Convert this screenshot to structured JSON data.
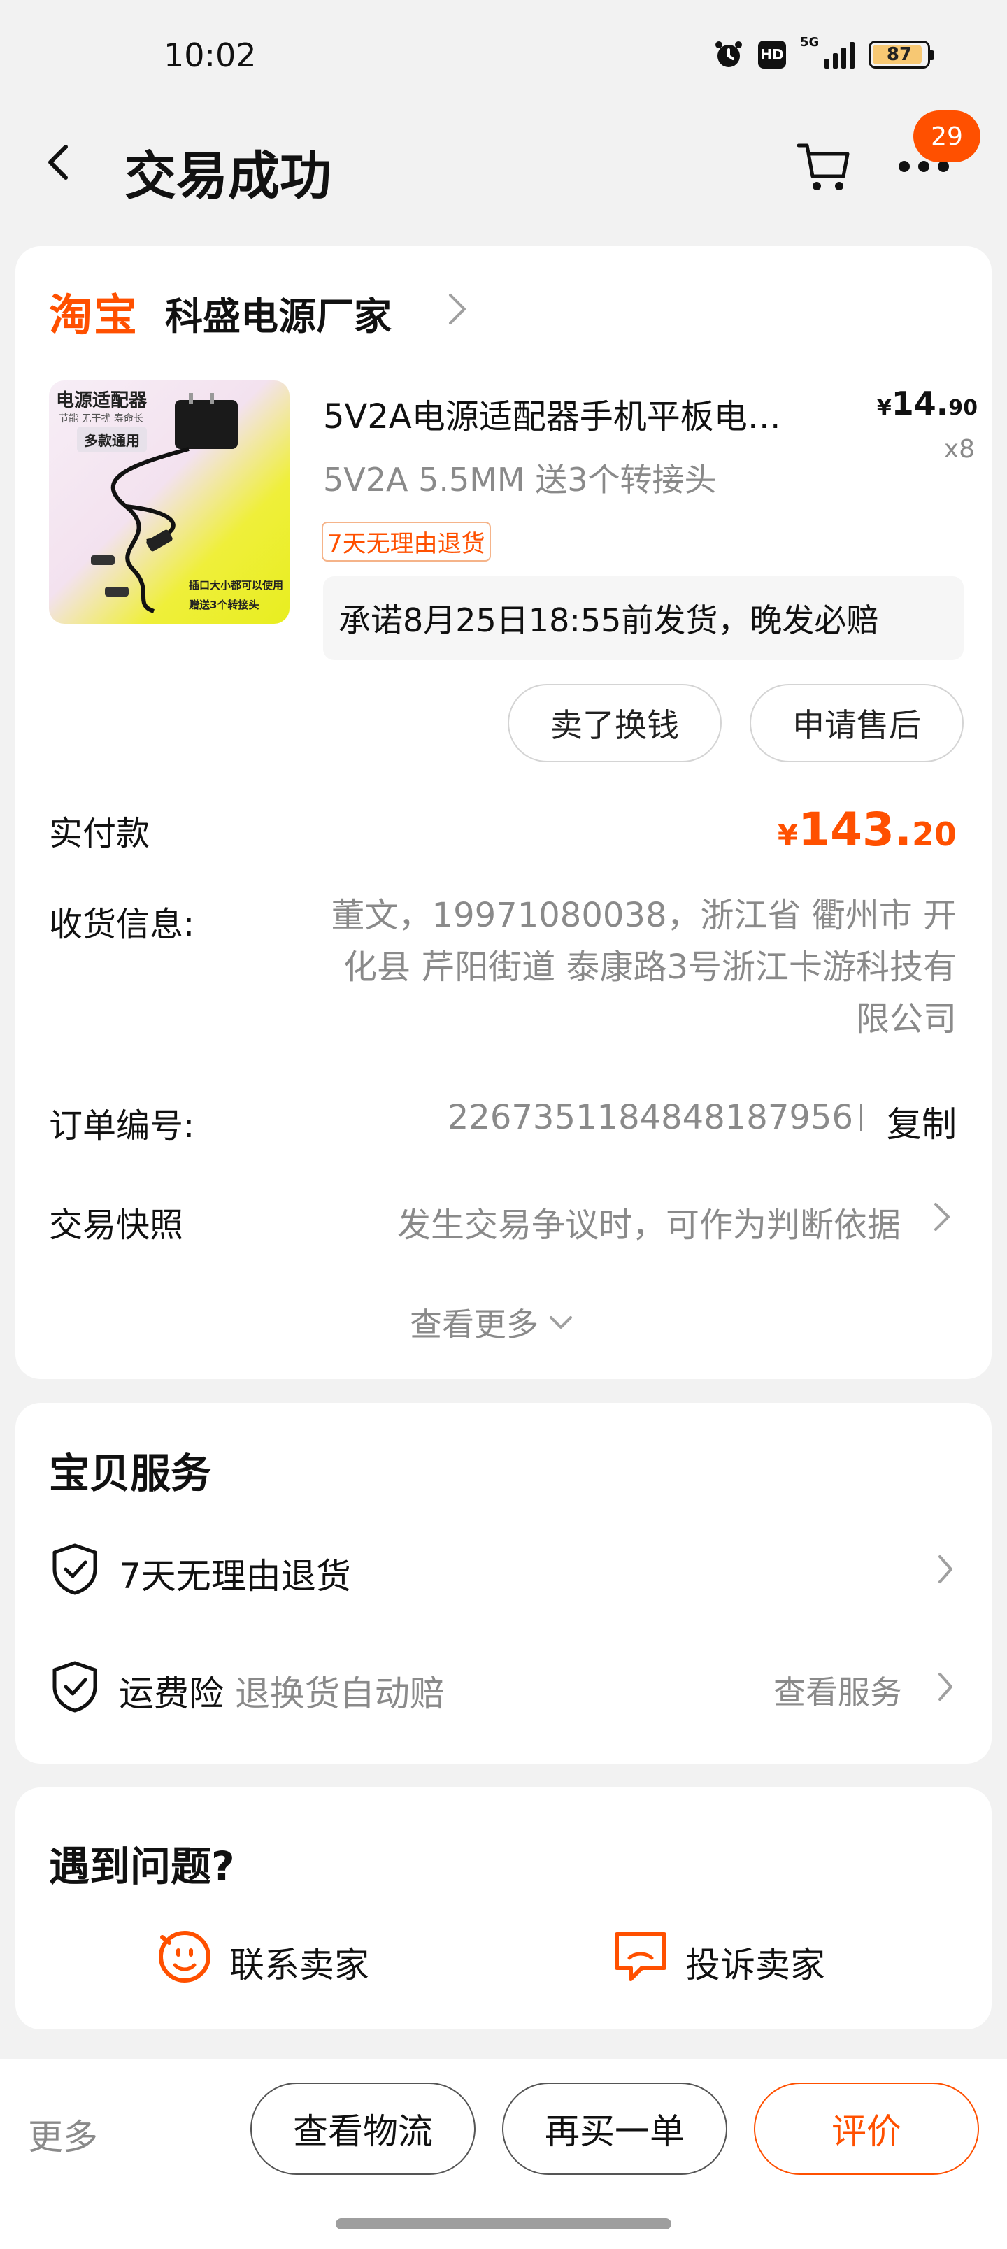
{
  "status_bar": {
    "time": "10:02",
    "hd": "HD",
    "network": "5G",
    "battery": "87"
  },
  "header": {
    "title": "交易成功",
    "badge_count": "29"
  },
  "shop": {
    "platform": "淘宝",
    "name": "科盛电源厂家"
  },
  "product": {
    "image_title": "电源适配器",
    "image_subtitle": "节能 无干扰 寿命长",
    "image_tag": "多款通用",
    "image_line1": "插口大小都可以使用",
    "image_line2": "赠送3个转接头",
    "title": "5V2A电源适配器手机平板电…",
    "price_yen": "¥",
    "price_int": "14.",
    "price_dec": "90",
    "quantity": "x8",
    "spec": "5V2A 5.5MM 送3个转接头",
    "tag": "7天无理由退货",
    "promise": "承诺8月25日18:55前发货，晚发必赔",
    "actions": [
      "卖了换钱",
      "申请售后"
    ]
  },
  "payment": {
    "label": "实付款",
    "yen": "¥",
    "amount_int": "143.",
    "amount_dec": "20"
  },
  "shipping": {
    "label": "收货信息:",
    "address": "董文，19971080038，浙江省 衢州市 开化县 芹阳街道  泰康路3号浙江卡游科技有限公司"
  },
  "order": {
    "label": "订单编号:",
    "number": "2267351184848187956",
    "copy": "复制"
  },
  "snapshot": {
    "label": "交易快照",
    "text": "发生交易争议时，可作为判断依据"
  },
  "view_more": "查看更多",
  "service": {
    "title": "宝贝服务",
    "items": [
      {
        "name": "7天无理由退货",
        "sub": "",
        "link": ""
      },
      {
        "name": "运费险",
        "sub": "退换货自动赔",
        "link": "查看服务"
      }
    ]
  },
  "help": {
    "title": "遇到问题?",
    "contact": "联系卖家",
    "complain": "投诉卖家"
  },
  "bottom": {
    "more": "更多",
    "logistics": "查看物流",
    "rebuy": "再买一单",
    "review": "评价"
  },
  "colors": {
    "accent": "#ff5000",
    "muted": "#8a8a8a",
    "background": "#f2f2f2"
  },
  "icons": [
    "back-arrow-icon",
    "cart-icon",
    "more-dots-icon",
    "chevron-right-icon",
    "chevron-down-icon",
    "shield-check-icon",
    "smile-chat-icon",
    "complaint-chat-icon"
  ]
}
